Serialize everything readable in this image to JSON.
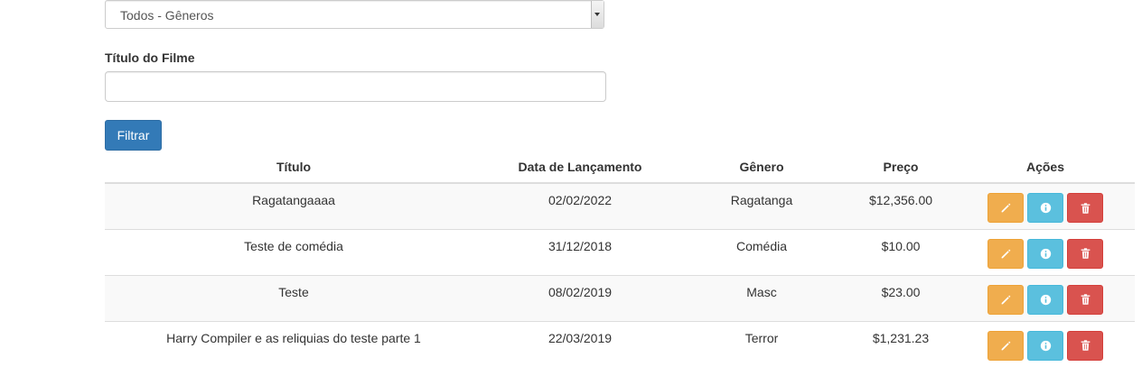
{
  "filters": {
    "genre_select": {
      "selected": "Todos - Gêneros"
    },
    "title_label": "Título do Filme",
    "title_input": {
      "value": "",
      "placeholder": ""
    },
    "filter_button": "Filtrar"
  },
  "table": {
    "headers": {
      "title": "Título",
      "release_date": "Data de Lançamento",
      "genre": "Gênero",
      "price": "Preço",
      "actions": "Ações"
    },
    "rows": [
      {
        "title": "Ragatangaaaa",
        "release_date": "02/02/2022",
        "genre": "Ragatanga",
        "price": "$12,356.00"
      },
      {
        "title": "Teste de comédia",
        "release_date": "31/12/2018",
        "genre": "Comédia",
        "price": "$10.00"
      },
      {
        "title": "Teste",
        "release_date": "08/02/2019",
        "genre": "Masc",
        "price": "$23.00"
      },
      {
        "title": "Harry Compiler e as reliquias do teste parte 1",
        "release_date": "22/03/2019",
        "genre": "Terror",
        "price": "$1,231.23"
      }
    ],
    "action_icons": [
      "pencil-icon",
      "info-icon",
      "trash-icon"
    ]
  },
  "colors": {
    "primary": "#337ab7",
    "warning": "#f0ad4e",
    "info": "#5bc0de",
    "danger": "#d9534f",
    "row_stripe": "#f9f9f9"
  }
}
